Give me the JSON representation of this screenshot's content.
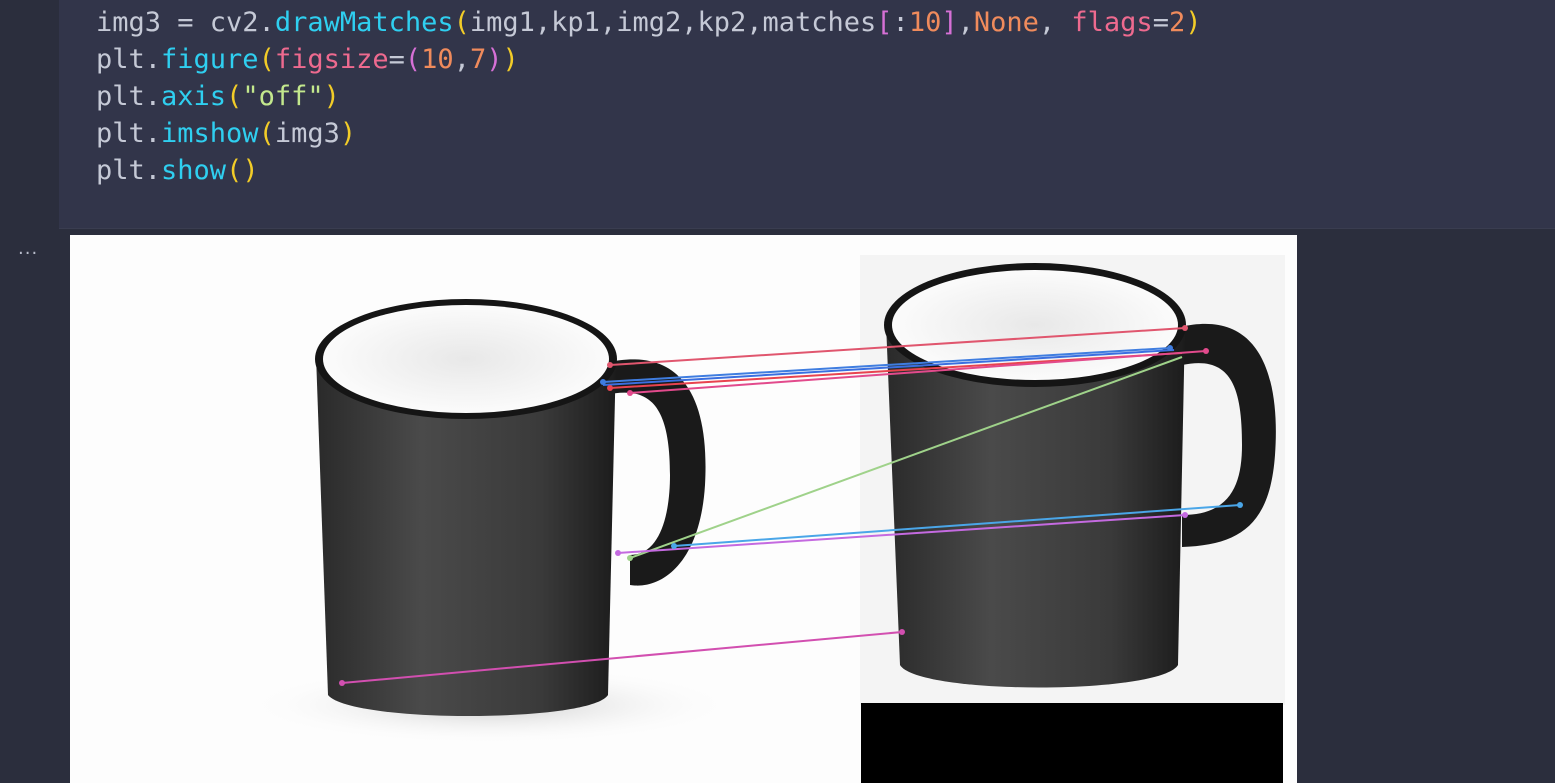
{
  "code_cell": {
    "lines": [
      [
        {
          "t": "img3 = cv2.",
          "c": "op"
        },
        {
          "t": "drawMatches",
          "c": "fn"
        },
        {
          "t": "(",
          "c": "paren"
        },
        {
          "t": "img1,kp1,img2,kp2,matches",
          "c": "op"
        },
        {
          "t": "[",
          "c": "bracket"
        },
        {
          "t": ":",
          "c": "op"
        },
        {
          "t": "10",
          "c": "num"
        },
        {
          "t": "]",
          "c": "bracket"
        },
        {
          "t": ",",
          "c": "op"
        },
        {
          "t": "None",
          "c": "kw"
        },
        {
          "t": ", ",
          "c": "op"
        },
        {
          "t": "flags",
          "c": "arg"
        },
        {
          "t": "=",
          "c": "op"
        },
        {
          "t": "2",
          "c": "num"
        },
        {
          "t": ")",
          "c": "paren"
        }
      ],
      [
        {
          "t": "plt.",
          "c": "op"
        },
        {
          "t": "figure",
          "c": "fn"
        },
        {
          "t": "(",
          "c": "paren"
        },
        {
          "t": "figsize",
          "c": "arg"
        },
        {
          "t": "=",
          "c": "op"
        },
        {
          "t": "(",
          "c": "bracket"
        },
        {
          "t": "10",
          "c": "num"
        },
        {
          "t": ",",
          "c": "op"
        },
        {
          "t": "7",
          "c": "num"
        },
        {
          "t": ")",
          "c": "bracket"
        },
        {
          "t": ")",
          "c": "paren"
        }
      ],
      [
        {
          "t": "plt.",
          "c": "op"
        },
        {
          "t": "axis",
          "c": "fn"
        },
        {
          "t": "(",
          "c": "paren"
        },
        {
          "t": "\"off\"",
          "c": "str"
        },
        {
          "t": ")",
          "c": "paren"
        }
      ],
      [
        {
          "t": "plt.",
          "c": "op"
        },
        {
          "t": "imshow",
          "c": "fn"
        },
        {
          "t": "(",
          "c": "paren"
        },
        {
          "t": "img3",
          "c": "op"
        },
        {
          "t": ")",
          "c": "paren"
        }
      ],
      [
        {
          "t": "plt.",
          "c": "op"
        },
        {
          "t": "show",
          "c": "fn"
        },
        {
          "t": "()",
          "c": "paren"
        }
      ]
    ]
  },
  "output": {
    "gutter_label": "...",
    "image_description_icon": "matched-mugs-image",
    "match_line_colors": [
      "#e0566e",
      "#3f7de0",
      "#e8434f",
      "#3a6fe0",
      "#e24a8c",
      "#9fd28a",
      "#4aa6e8",
      "#c46ae0",
      "#d24fb0",
      "#5a5ad8"
    ]
  },
  "colors": {
    "background": "#2b2e3d",
    "cell_background": "#32354a",
    "function": "#2fcff0",
    "paren": "#f2cc28",
    "number": "#f08b5c",
    "keyword_arg": "#ee6a8f",
    "string": "#c3e88d"
  }
}
